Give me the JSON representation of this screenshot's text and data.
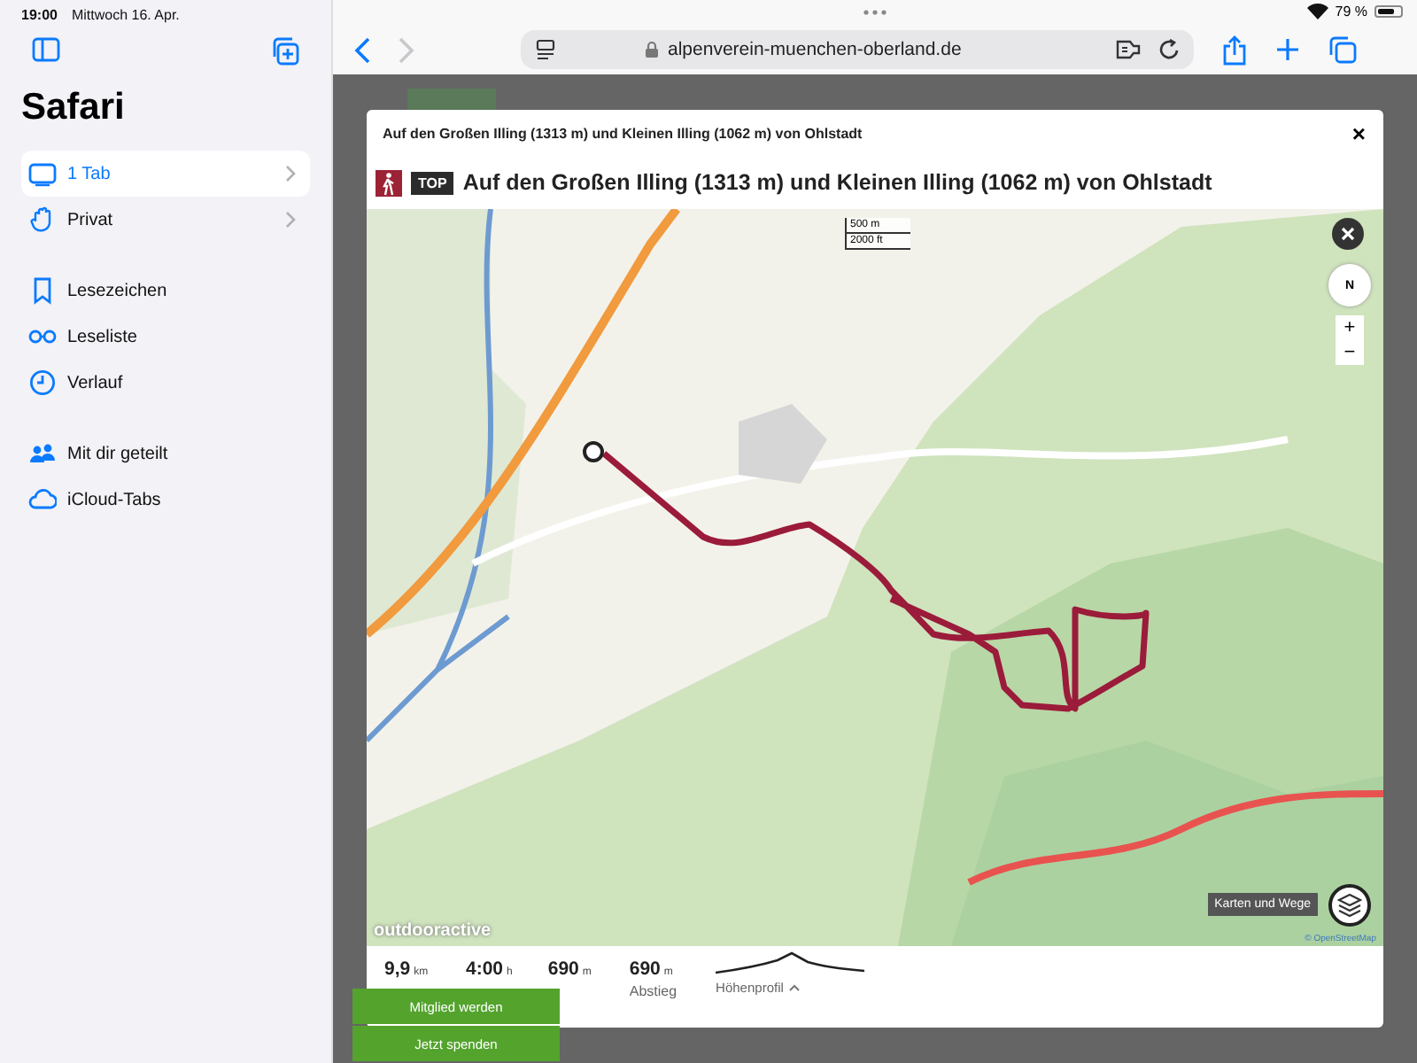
{
  "status_bar": {
    "time": "19:00",
    "date": "Mittwoch 16. Apr.",
    "battery": "79 %"
  },
  "sidebar": {
    "title": "Safari",
    "groups": [
      [
        {
          "label": "1 Tab",
          "selected": true,
          "chevron": true
        },
        {
          "label": "Privat",
          "selected": false,
          "chevron": true
        }
      ],
      [
        {
          "label": "Lesezeichen",
          "selected": false,
          "chevron": false
        },
        {
          "label": "Leseliste",
          "selected": false,
          "chevron": false
        },
        {
          "label": "Verlauf",
          "selected": false,
          "chevron": false
        }
      ],
      [
        {
          "label": "Mit dir geteilt",
          "selected": false,
          "chevron": false
        },
        {
          "label": "iCloud-Tabs",
          "selected": false,
          "chevron": false
        }
      ]
    ]
  },
  "toolbar": {
    "url": "alpenverein-muenchen-oberland.de"
  },
  "dialog": {
    "caption": "Auf den Großen Illing (1313 m) und Kleinen Illing (1062 m) von Ohlstadt",
    "close": "×",
    "badge": "TOP",
    "title": "Auf den Großen Illing (1313 m) und Kleinen Illing (1062 m) von Ohlstadt",
    "map": {
      "scale": [
        "500 m",
        "2000 ft"
      ],
      "compass": "N",
      "zoom": [
        "+",
        "−"
      ],
      "layers_tooltip": "Karten und Wege",
      "logo": "outdooractive",
      "attribution": "© OpenStreetMap"
    },
    "stats": [
      {
        "value": "9,9",
        "unit": "km"
      },
      {
        "value": "4:00",
        "unit": "h"
      },
      {
        "value": "690",
        "unit": "m"
      },
      {
        "value": "690",
        "unit": "m",
        "label": "Abstieg"
      }
    ],
    "profile_label": "Höhenprofil"
  },
  "overlay_buttons": [
    "Mitglied werden",
    "Jetzt spenden"
  ]
}
